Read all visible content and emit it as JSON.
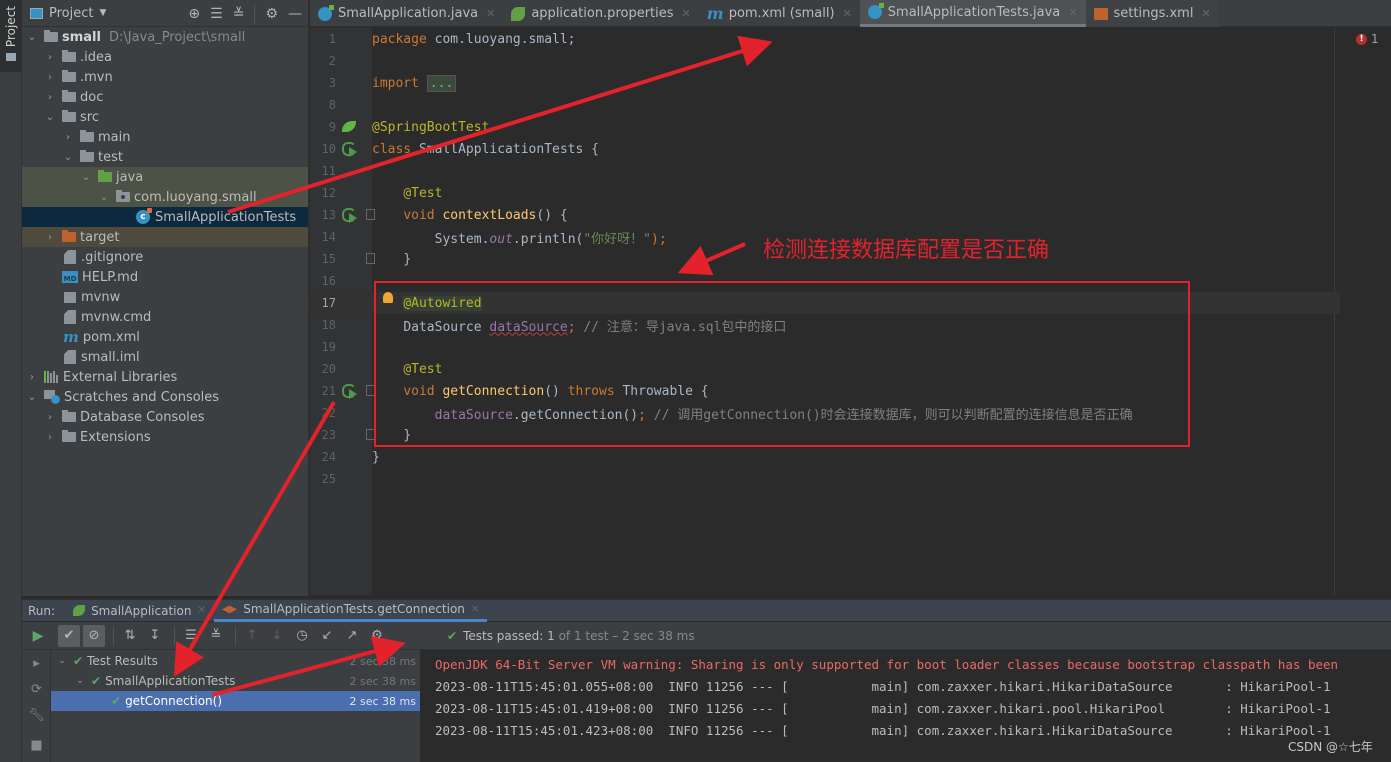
{
  "left_stripe": {
    "project_label": "Project"
  },
  "project_panel": {
    "title": "Project",
    "tree": [
      {
        "label": "small",
        "path": "D:\\Java_Project\\small",
        "type": "module",
        "expanded": true,
        "depth": 0
      },
      {
        "label": ".idea",
        "type": "folder",
        "expanded": false,
        "depth": 1
      },
      {
        "label": ".mvn",
        "type": "folder",
        "expanded": false,
        "depth": 1
      },
      {
        "label": "doc",
        "type": "folder",
        "expanded": false,
        "depth": 1
      },
      {
        "label": "src",
        "type": "folder",
        "expanded": true,
        "depth": 1
      },
      {
        "label": "main",
        "type": "folder",
        "expanded": false,
        "depth": 2
      },
      {
        "label": "test",
        "type": "folder",
        "expanded": true,
        "depth": 2
      },
      {
        "label": "java",
        "type": "test-source-folder",
        "expanded": true,
        "depth": 3
      },
      {
        "label": "com.luoyang.small",
        "type": "package",
        "expanded": true,
        "depth": 4
      },
      {
        "label": "SmallApplicationTests",
        "type": "class",
        "depth": 5,
        "selected": true
      },
      {
        "label": "target",
        "type": "excluded-folder",
        "expanded": false,
        "depth": 1
      },
      {
        "label": ".gitignore",
        "type": "file",
        "depth": 1
      },
      {
        "label": "HELP.md",
        "type": "markdown",
        "depth": 1
      },
      {
        "label": "mvnw",
        "type": "script",
        "depth": 1
      },
      {
        "label": "mvnw.cmd",
        "type": "file",
        "depth": 1
      },
      {
        "label": "pom.xml",
        "type": "maven",
        "depth": 1
      },
      {
        "label": "small.iml",
        "type": "file",
        "depth": 1
      },
      {
        "label": "External Libraries",
        "type": "libraries",
        "expanded": false,
        "depth": 0
      },
      {
        "label": "Scratches and Consoles",
        "type": "scratches",
        "expanded": true,
        "depth": 0
      },
      {
        "label": "Database Consoles",
        "type": "folder",
        "expanded": false,
        "depth": 1
      },
      {
        "label": "Extensions",
        "type": "folder",
        "expanded": false,
        "depth": 1
      }
    ]
  },
  "editor_tabs": [
    {
      "label": "SmallApplication.java",
      "icon": "spring-boot-class-icon",
      "active": false
    },
    {
      "label": "application.properties",
      "icon": "spring-properties-icon",
      "active": false
    },
    {
      "label": "pom.xml (small)",
      "icon": "maven-icon",
      "active": false
    },
    {
      "label": "SmallApplicationTests.java",
      "icon": "test-class-icon",
      "active": true
    },
    {
      "label": "settings.xml",
      "icon": "xml-file-icon",
      "active": false
    }
  ],
  "editor": {
    "error_count": "1",
    "lines": [
      {
        "n": "1",
        "code": "package com.luoyang.small;"
      },
      {
        "n": "2",
        "code": ""
      },
      {
        "n": "3",
        "code": "import ..."
      },
      {
        "n": "8",
        "code": ""
      },
      {
        "n": "9",
        "code": "@SpringBootTest"
      },
      {
        "n": "10",
        "code": "class SmallApplicationTests {"
      },
      {
        "n": "11",
        "code": ""
      },
      {
        "n": "12",
        "code": "    @Test"
      },
      {
        "n": "13",
        "code": "    void contextLoads() {"
      },
      {
        "n": "14",
        "code": "        System.out.println(\"你好呀！\");"
      },
      {
        "n": "15",
        "code": "    }"
      },
      {
        "n": "16",
        "code": ""
      },
      {
        "n": "17",
        "code": "    @Autowired"
      },
      {
        "n": "18",
        "code": "    DataSource dataSource; // 注意：导java.sql包中的接口"
      },
      {
        "n": "19",
        "code": ""
      },
      {
        "n": "20",
        "code": "    @Test"
      },
      {
        "n": "21",
        "code": "    void getConnection() throws Throwable {"
      },
      {
        "n": "22",
        "code": "        dataSource.getConnection(); // 调用getConnection()时会连接数据库，则可以判断配置的连接信息是否正确"
      },
      {
        "n": "23",
        "code": "    }"
      },
      {
        "n": "24",
        "code": "}"
      },
      {
        "n": "25",
        "code": ""
      }
    ],
    "tokens": {
      "package_kw": "package",
      "package_name": " com.luoyang.small;",
      "import_kw": "import",
      "import_fold": "...",
      "springboottest": "@SpringBootTest",
      "class_kw": "class",
      "class_name": " SmallApplicationTests {",
      "test_ann": "@Test",
      "void_kw": "void",
      "contextloads_fn": "contextLoads",
      "contextloads_rest": "() {",
      "system": "System.",
      "out": "out",
      "println": ".println(",
      "hello_str": "\"你好呀！\"",
      "println_end": ");",
      "close_brace": "}",
      "autowired": "@Autowired",
      "datasource_type": "DataSource ",
      "datasource_field": "dataSource",
      "semicolon": ";",
      "comment18": " // 注意：导java.sql包中的接口",
      "getconnection_fn": "getConnection",
      "getconn_paren": "() ",
      "throws_kw": "throws",
      "throwable": " Throwable {",
      "datasource_call": "dataSource",
      "getconn_call": ".getConnection()",
      "comment22": " // 调用getConnection()时会连接数据库，则可以判断配置的连接信息是否正确"
    }
  },
  "annotation": {
    "callout_text": "检测连接数据库配置是否正确",
    "color": "#e3222c"
  },
  "run_panel": {
    "label": "Run:",
    "tabs": [
      {
        "label": "SmallApplication",
        "active": false
      },
      {
        "label": "SmallApplicationTests.getConnection",
        "active": true
      }
    ],
    "status": {
      "passed_label": "Tests passed:",
      "passed_count": "1",
      "detail": "of 1 test – 2 sec 38 ms"
    },
    "test_tree": [
      {
        "label": "Test Results",
        "time": "2 sec 38 ms",
        "depth": 0
      },
      {
        "label": "SmallApplicationTests",
        "time": "2 sec 38 ms",
        "depth": 1
      },
      {
        "label": "getConnection()",
        "time": "2 sec 38 ms",
        "depth": 2,
        "selected": true
      }
    ],
    "console": [
      {
        "text": "OpenJDK 64-Bit Server VM warning: Sharing is only supported for boot loader classes because bootstrap classpath has been",
        "level": "warn"
      },
      {
        "text": "2023-08-11T15:45:01.055+08:00  INFO 11256 --- [           main] com.zaxxer.hikari.HikariDataSource       : HikariPool-1",
        "level": "info"
      },
      {
        "text": "2023-08-11T15:45:01.419+08:00  INFO 11256 --- [           main] com.zaxxer.hikari.pool.HikariPool        : HikariPool-1",
        "level": "info"
      },
      {
        "text": "2023-08-11T15:45:01.423+08:00  INFO 11256 --- [           main] com.zaxxer.hikari.HikariDataSource       : HikariPool-1",
        "level": "info"
      }
    ]
  },
  "watermark": "CSDN @☆七年"
}
